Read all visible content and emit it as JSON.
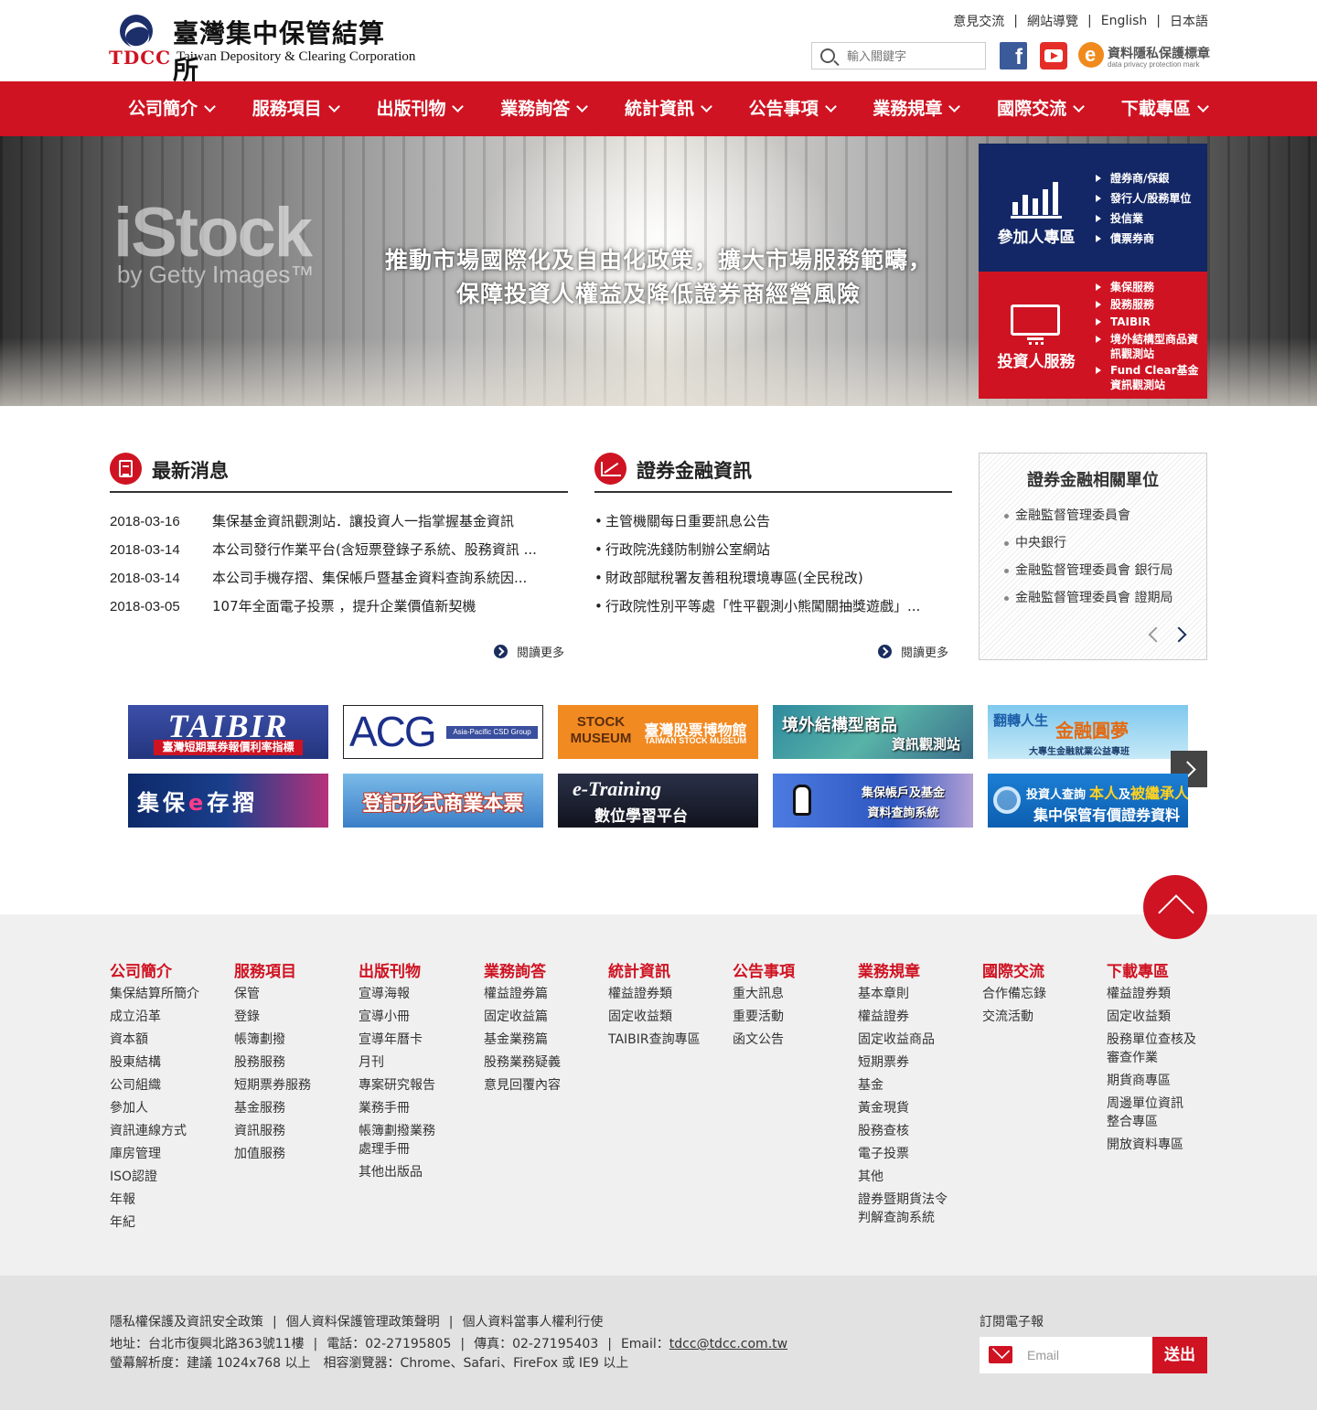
{
  "logo": {
    "abbr": "TDCC",
    "name_cn": "臺灣集中保管結算所",
    "name_en": "Taiwan Depository & Clearing Corporation"
  },
  "top_links": [
    "意見交流",
    "網站導覽",
    "English",
    "日本語"
  ],
  "search": {
    "placeholder": "輸入關鍵字"
  },
  "social": {
    "facebook": "f"
  },
  "privacy_mark": {
    "title": "資料隱私保護標章",
    "subtitle": "data privacy protection mark"
  },
  "nav": [
    "公司簡介",
    "服務項目",
    "出版刊物",
    "業務詢答",
    "統計資訊",
    "公告事項",
    "業務規章",
    "國際交流",
    "下載專區"
  ],
  "banner": {
    "watermark_main": "iStock",
    "watermark_sub": "by Getty Images™",
    "line1": "推動市場國際化及自由化政策，擴大市場服務範疇，",
    "line2": "保障投資人權益及降低證券商經營風險"
  },
  "participant_panel": {
    "title": "參加人專區",
    "items": [
      "證券商/保銀",
      "發行人/股務單位",
      "投信業",
      "債票券商"
    ]
  },
  "investor_panel": {
    "title": "投資人服務",
    "items": [
      "集保服務",
      "股務服務",
      "TAIBIR",
      "境外結構型商品資訊觀測站",
      "Fund Clear基金資訊觀測站"
    ]
  },
  "latest_news": {
    "title": "最新消息",
    "items": [
      {
        "date": "2018-03-16",
        "text": "集保基金資訊觀測站．讓投資人一指掌握基金資訊"
      },
      {
        "date": "2018-03-14",
        "text": "本公司發行作業平台(含短票登錄子系統、股務資訊 ..."
      },
      {
        "date": "2018-03-14",
        "text": "本公司手機存摺、集保帳戶暨基金資料查詢系統因..."
      },
      {
        "date": "2018-03-05",
        "text": "107年全面電子投票 ，提升企業價值新契機"
      }
    ],
    "more": "閱讀更多"
  },
  "finance_info": {
    "title": "證券金融資訊",
    "items": [
      "主管機關每日重要訊息公告",
      "行政院洗錢防制辦公室網站",
      "財政部賦稅署友善租稅環境專區(全民稅改)",
      "行政院性別平等處「性平觀測小熊闖關抽獎遊戲」..."
    ],
    "more": "閱讀更多"
  },
  "related_units": {
    "title": "證券金融相關單位",
    "items": [
      "金融監督管理委員會",
      "中央銀行",
      "金融監督管理委員會 銀行局",
      "金融監督管理委員會 證期局"
    ]
  },
  "link_banners": {
    "taibir": {
      "title": "TAIBIR",
      "sub": "臺灣短期票券報價利率指標"
    },
    "acg": {
      "title": "ACG",
      "sub": "Asia-Pacific CSD Group"
    },
    "museum": {
      "title": "STOCK MUSEUM",
      "name": "臺灣股票博物館",
      "sub": "TAIWAN STOCK MUSEUM"
    },
    "offshore": {
      "line1": "境外結構型商品",
      "line2": "資訊觀測站"
    },
    "dream": {
      "title_a": "翻轉人生",
      "title_b": "金融圓夢",
      "sub": "大專生金融就業公益專班"
    },
    "ebook": {
      "a": "集保",
      "b": "e",
      "c": "存摺"
    },
    "paper": {
      "title": "登記形式商業本票"
    },
    "etraining": {
      "title": "e-Training",
      "sub": "數位學習平台"
    },
    "account": {
      "line1": "集保帳戶及基金",
      "line2": "資料查詢系統"
    },
    "inquiry": {
      "line1_a": "投資人查詢",
      "line1_b": "本人",
      "line1_c": "及",
      "line1_d": "被繼承人",
      "line2": "集中保管有價證券資料"
    }
  },
  "sitemap": [
    {
      "title": "公司簡介",
      "items": [
        "集保結算所簡介",
        "成立沿革",
        "資本額",
        "股東結構",
        "公司組織",
        "參加人",
        "資訊連線方式",
        "庫房管理",
        "ISO認證",
        "年報",
        "年紀"
      ]
    },
    {
      "title": "服務項目",
      "items": [
        "保管",
        "登錄",
        "帳簿劃撥",
        "股務服務",
        "短期票券服務",
        "基金服務",
        "資訊服務",
        "加值服務"
      ]
    },
    {
      "title": "出版刊物",
      "items": [
        "宣導海報",
        "宣導小冊",
        "宣導年曆卡",
        "月刊",
        "專案研究報告",
        "業務手冊",
        "帳簿劃撥業務\n處理手冊",
        "其他出版品"
      ]
    },
    {
      "title": "業務詢答",
      "items": [
        "權益證券篇",
        "固定收益篇",
        "基金業務篇",
        "股務業務疑義",
        "意見回覆內容"
      ]
    },
    {
      "title": "統計資訊",
      "items": [
        "權益證券類",
        "固定收益類",
        "TAIBIR查詢專區"
      ]
    },
    {
      "title": "公告事項",
      "items": [
        "重大訊息",
        "重要活動",
        "函文公告"
      ]
    },
    {
      "title": "業務規章",
      "items": [
        "基本章則",
        "權益證券",
        "固定收益商品",
        "短期票券",
        "基金",
        "黃金現貨",
        "股務查核",
        "電子投票",
        "其他",
        "證券暨期貨法令\n判解查詢系統"
      ]
    },
    {
      "title": "國際交流",
      "items": [
        "合作備忘錄",
        "交流活動"
      ]
    },
    {
      "title": "下載專區",
      "items": [
        "權益證券類",
        "固定收益類",
        "股務單位查核及\n審查作業",
        "期貨商專區",
        "周邊單位資訊\n整合專區",
        "開放資料專區"
      ]
    }
  ],
  "footer": {
    "links": [
      "隱私權保護及資訊安全政策",
      "個人資料保護管理政策聲明",
      "個人資料當事人權利行使"
    ],
    "address": "地址：台北市復興北路363號11樓",
    "phone": "電話：02-27195805",
    "fax": "傳真：02-27195403",
    "email_label": "Email：",
    "email": "tdcc@tdcc.com.tw",
    "screen_info": "螢幕解析度：建議 1024x768 以上　相容瀏覽器：Chrome、Safari、FireFox 或 IE9 以上",
    "subscribe_label": "訂閱電子報",
    "email_placeholder": "Email",
    "submit": "送出"
  },
  "colors": {
    "brand_red": "#cf1322",
    "navy": "#132766",
    "footer_bg": "#f0f0f0"
  }
}
